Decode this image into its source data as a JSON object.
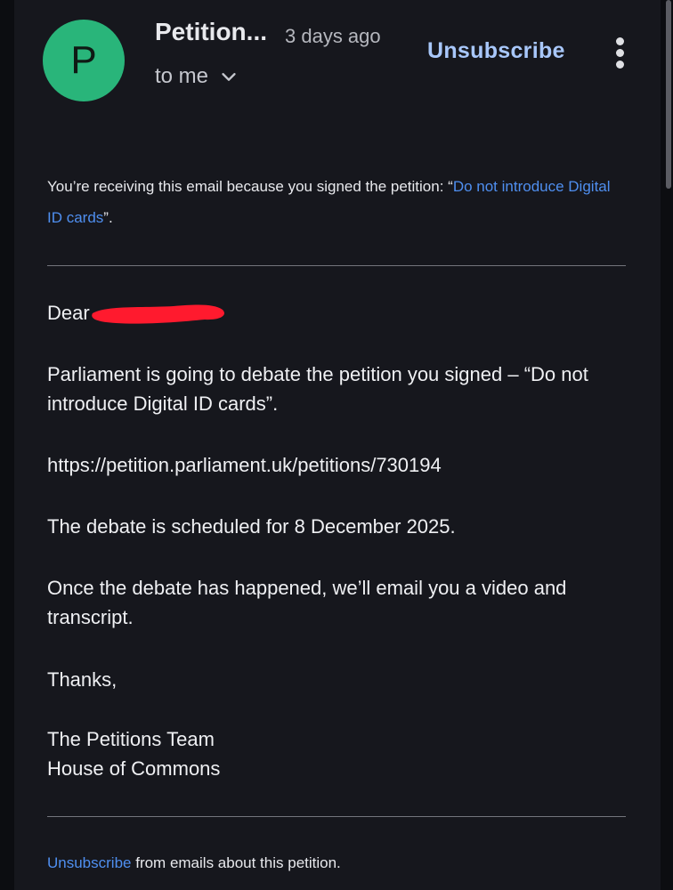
{
  "header": {
    "avatar_letter": "P",
    "sender": "Petition...",
    "time": "3 days ago",
    "recipient": "to me",
    "unsubscribe": "Unsubscribe"
  },
  "notice": {
    "prefix": "You’re receiving this email because you signed the petition: “",
    "link": "Do not introduce Digital ID cards",
    "suffix": "”."
  },
  "body": {
    "greeting": "Dear",
    "debate_line": "Parliament is going to debate the petition you signed – “Do not introduce Digital ID cards”.",
    "url": "https://petition.parliament.uk/petitions/730194",
    "scheduled": "The debate is scheduled for 8 December 2025.",
    "followup": "Once the debate has happened, we’ll email you a video and transcript.",
    "thanks": "Thanks,",
    "sign_team": "The Petitions Team",
    "sign_org": "House of Commons"
  },
  "footer": {
    "link": "Unsubscribe",
    "text": " from emails about this petition."
  },
  "colors": {
    "avatar": "#29b57a",
    "link": "#4f8ff0",
    "accent": "#a8c7fa",
    "redaction": "#ff1a2e"
  }
}
